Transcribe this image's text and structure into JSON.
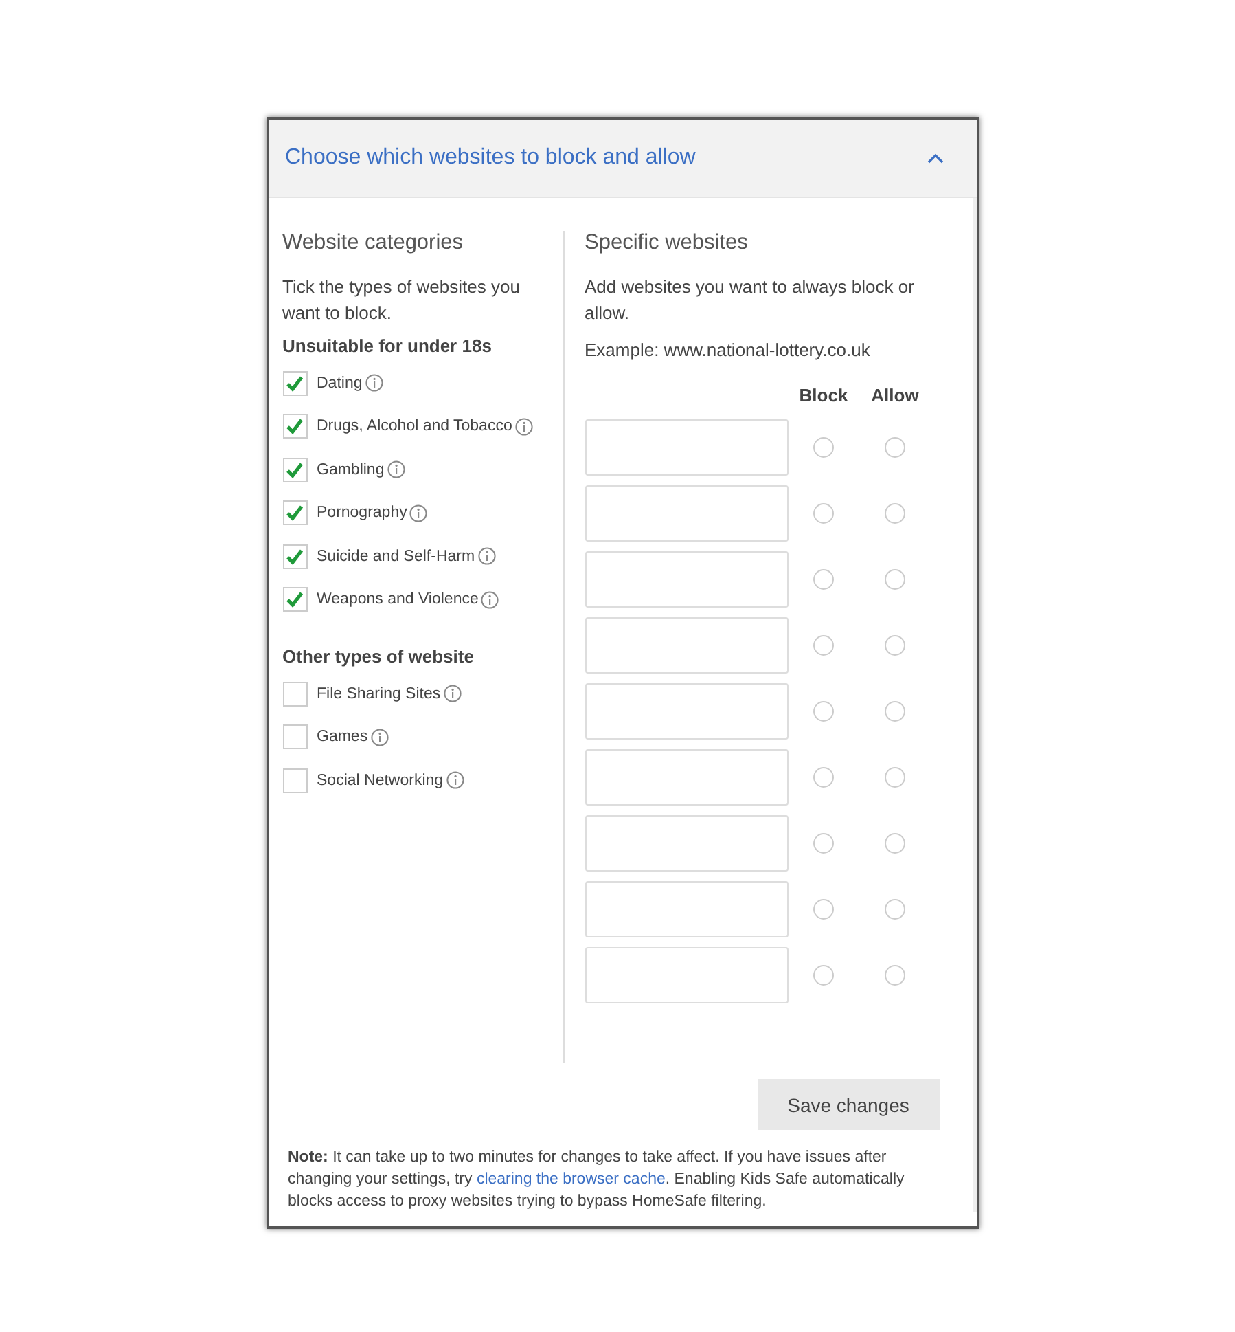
{
  "panel": {
    "title": "Choose which websites to block and allow",
    "expanded": true
  },
  "categories": {
    "heading": "Website categories",
    "intro": "Tick the types of websites you want to block.",
    "groups": [
      {
        "heading": "Unsuitable for under 18s",
        "items": [
          {
            "label": "Dating",
            "checked": true
          },
          {
            "label": "Drugs, Alcohol and Tobacco",
            "checked": true
          },
          {
            "label": "Gambling",
            "checked": true
          },
          {
            "label": "Pornography",
            "checked": true
          },
          {
            "label": "Suicide and Self-Harm",
            "checked": true
          },
          {
            "label": "Weapons and Violence",
            "checked": true
          }
        ]
      },
      {
        "heading": "Other types of website",
        "items": [
          {
            "label": "File Sharing Sites",
            "checked": false
          },
          {
            "label": "Games",
            "checked": false
          },
          {
            "label": "Social Networking",
            "checked": false
          }
        ]
      }
    ]
  },
  "specific": {
    "heading": "Specific websites",
    "intro": "Add websites you want to always block or allow.",
    "example": "Example: www.national-lottery.co.uk",
    "columns": [
      "Block",
      "Allow"
    ],
    "rows": [
      {
        "block": false,
        "allow": false
      },
      {
        "block": false,
        "allow": false
      },
      {
        "block": false,
        "allow": false
      },
      {
        "block": false,
        "allow": false
      },
      {
        "block": false,
        "allow": false
      },
      {
        "block": false,
        "allow": false
      },
      {
        "block": false,
        "allow": false
      },
      {
        "block": false,
        "allow": false
      },
      {
        "block": false,
        "allow": false
      }
    ]
  },
  "save_button": "Save changes",
  "note": {
    "before": "**Note:** It can take up to two minutes for changes to take affect. If you have issues after changing your settings, try ",
    "link": "clearing the browser cache",
    "after": ". Enabling Kids Safe automatically blocks access to proxy websites trying to bypass HomeSafe filtering."
  }
}
